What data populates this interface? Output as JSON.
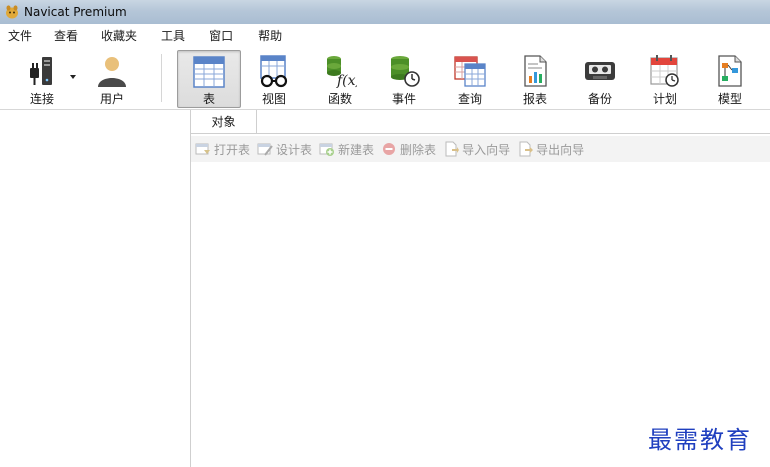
{
  "window": {
    "title": "Navicat Premium"
  },
  "menu": {
    "items": [
      "文件",
      "查看",
      "收藏夹",
      "工具",
      "窗口",
      "帮助"
    ]
  },
  "toolbar": {
    "connect": "连接",
    "user": "用户",
    "table": "表",
    "view": "视图",
    "function": "函数",
    "event": "事件",
    "query": "查询",
    "report": "报表",
    "backup": "备份",
    "schedule": "计划",
    "model": "模型"
  },
  "tabs": {
    "objects": "对象"
  },
  "object_toolbar": {
    "open_table": "打开表",
    "design_table": "设计表",
    "new_table": "新建表",
    "delete_table": "删除表",
    "import_wizard": "导入向导",
    "export_wizard": "导出向导"
  },
  "watermark": "最需教育"
}
